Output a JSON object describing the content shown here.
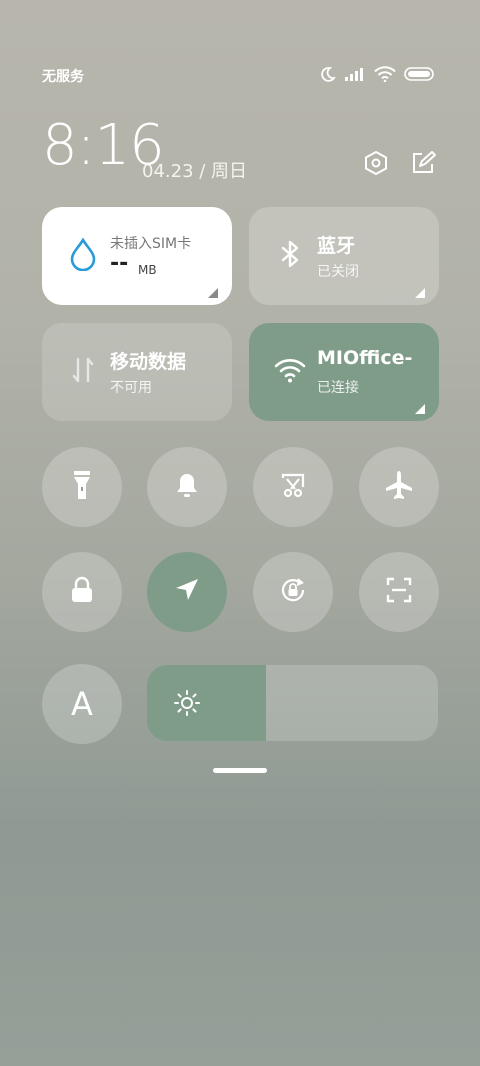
{
  "status_bar": {
    "carrier_text": "无服务",
    "icons": [
      "moon-icon",
      "signal-icon",
      "wifi-icon",
      "battery-icon"
    ]
  },
  "header": {
    "time": "8:16",
    "date": "04.23 / 周日",
    "icons": [
      "settings-icon",
      "edit-icon"
    ]
  },
  "tiles": {
    "data_usage": {
      "title": "未插入SIM卡",
      "value": "--",
      "unit": "MB",
      "icon": "drop-icon"
    },
    "bluetooth": {
      "title": "蓝牙",
      "subtitle": "已关闭",
      "icon": "bluetooth-icon"
    },
    "mobile_data": {
      "title": "移动数据",
      "subtitle": "不可用",
      "icon": "data-arrows-icon"
    },
    "wifi": {
      "title": "MIOffice-",
      "subtitle": "已连接",
      "icon": "wifi-icon"
    }
  },
  "toggles_row1": [
    "flashlight-icon",
    "bell-icon",
    "screenshot-icon",
    "airplane-icon"
  ],
  "toggles_row2": [
    "lock-icon",
    "location-icon",
    "rotation-lock-icon",
    "scan-icon"
  ],
  "font_button_label": "A",
  "brightness": {
    "level": 0.41,
    "icon": "sun-icon"
  },
  "colors": {
    "accent": "#7f9c88"
  }
}
